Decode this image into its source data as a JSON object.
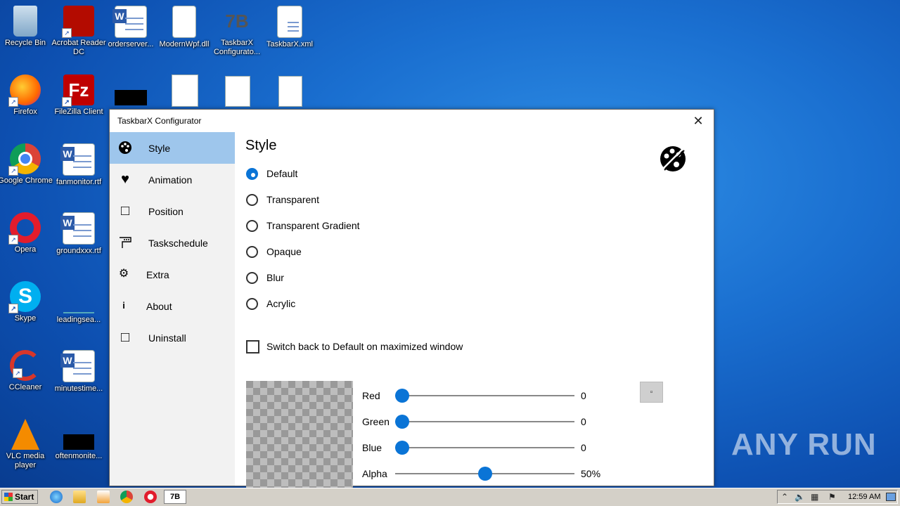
{
  "desktop": {
    "icons": [
      {
        "label": "Recycle Bin"
      },
      {
        "label": "Acrobat Reader DC"
      },
      {
        "label": "orderserver..."
      },
      {
        "label": "ModernWpf.dll"
      },
      {
        "label": "TaskbarX Configurato..."
      },
      {
        "label": "TaskbarX.xml"
      },
      {
        "label": "Firefox"
      },
      {
        "label": "FileZilla Client"
      },
      {
        "label": "Google Chrome"
      },
      {
        "label": "fanmonitor.rtf"
      },
      {
        "label": "Opera"
      },
      {
        "label": "groundxxx.rtf"
      },
      {
        "label": "Skype"
      },
      {
        "label": "leadingsea..."
      },
      {
        "label": "CCleaner"
      },
      {
        "label": "minutestime..."
      },
      {
        "label": "VLC media player"
      },
      {
        "label": "oftenmonite..."
      }
    ]
  },
  "window": {
    "title": "TaskbarX Configurator",
    "close_glyph": "✕",
    "nav": [
      {
        "label": "Style",
        "icon": "palette-icon",
        "glyph": "🎨"
      },
      {
        "label": "Animation",
        "icon": "heart-icon",
        "glyph": "♥"
      },
      {
        "label": "Position",
        "icon": "square-icon",
        "glyph": "□"
      },
      {
        "label": "Taskschedule",
        "icon": "schedule-icon",
        "glyph": "☐"
      },
      {
        "label": "Extra",
        "icon": "gear-icon",
        "glyph": "⚙"
      },
      {
        "label": "About",
        "icon": "info-icon",
        "glyph": "i"
      },
      {
        "label": "Uninstall",
        "icon": "square-icon",
        "glyph": "□"
      }
    ],
    "heading": "Style",
    "style_options": [
      "Default",
      "Transparent",
      "Transparent Gradient",
      "Opaque",
      "Blur",
      "Acrylic"
    ],
    "selected_style": "Default",
    "switch_back_label": "Switch back to Default on maximized window",
    "switch_back_checked": false,
    "sliders": [
      {
        "label": "Red",
        "value": "0",
        "fraction": 0.0
      },
      {
        "label": "Green",
        "value": "0",
        "fraction": 0.0
      },
      {
        "label": "Blue",
        "value": "0",
        "fraction": 0.0
      },
      {
        "label": "Alpha",
        "value": "50%",
        "fraction": 0.5
      }
    ],
    "accent_color": "#0a74d6"
  },
  "taskbar": {
    "start_label": "Start",
    "active_app_label": "7B",
    "clock": "12:59 AM"
  },
  "watermark": "ANY RUN"
}
